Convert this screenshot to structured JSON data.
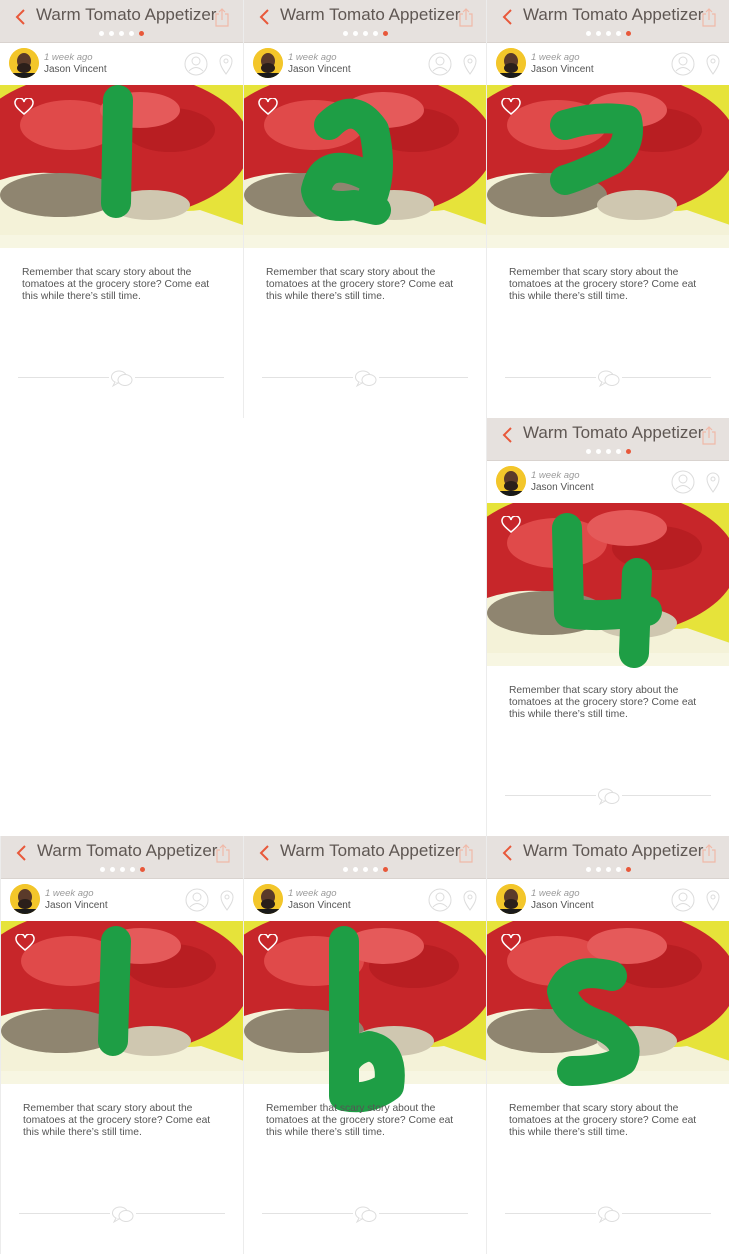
{
  "screens": [
    {
      "step": "1",
      "title": "Warm Tomato Appetizer",
      "time": "1 week ago",
      "author": "Jason Vincent",
      "description": "Remember that scary story about the tomatoes at the grocery store? Come eat this while there’s still time.",
      "active_dot": 5
    },
    {
      "step": "2",
      "title": "Warm Tomato Appetizer",
      "time": "1 week ago",
      "author": "Jason Vincent",
      "description": "Remember that scary story about the tomatoes at the grocery store? Come eat this while there’s still time.",
      "active_dot": 5
    },
    {
      "step": "7",
      "title": "Warm Tomato Appetizer",
      "time": "1 week ago",
      "author": "Jason Vincent",
      "description": "Remember that scary story about the tomatoes at the grocery store? Come eat this while there’s still time.",
      "active_dot": 5
    },
    {
      "step": "4",
      "title": "Warm Tomato Appetizer",
      "time": "1 week ago",
      "author": "Jason Vincent",
      "description": "Remember that scary story about the tomatoes at the grocery store? Come eat this while there’s still time.",
      "active_dot": 5
    },
    {
      "step": "1",
      "title": "Warm Tomato Appetizer",
      "time": "1 week ago",
      "author": "Jason Vincent",
      "description": "Remember that scary story about the tomatoes at the grocery store? Come eat this while there’s still time.",
      "active_dot": 5
    },
    {
      "step": "6",
      "title": "Warm Tomato Appetizer",
      "time": "1 week ago",
      "author": "Jason Vincent",
      "description": "Remember that scary story about the tomatoes at the grocery store? Come eat this while there’s still time.",
      "active_dot": 5
    },
    {
      "step": "5",
      "title": "Warm Tomato Appetizer",
      "time": "1 week ago",
      "author": "Jason Vincent",
      "description": "Remember that scary story about the tomatoes at the grocery store? Come eat this while there’s still time.",
      "active_dot": 5
    }
  ],
  "page_dots_count": 5,
  "icons": {
    "back": "chevron-left-icon",
    "share": "share-icon",
    "profile": "profile-icon",
    "location": "location-pin-icon",
    "like": "heart-icon",
    "comment": "comment-bubbles-icon"
  },
  "colors": {
    "accent": "#e8583a",
    "navbar_bg": "#e6e1de",
    "handwriting_green": "#1e9e45"
  }
}
